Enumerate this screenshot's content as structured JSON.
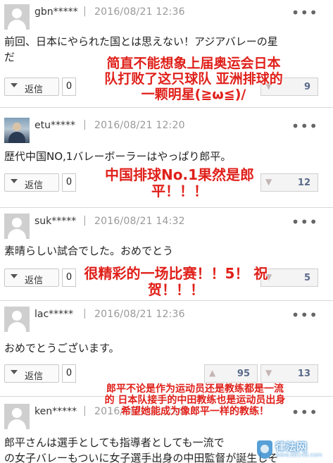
{
  "comments": [
    {
      "user": "gbn*****",
      "sep": "|",
      "date": "2016/08/21 12:36",
      "text_lines": [
        "前回、日本にやられた国とは思えない！アジアバレーの星",
        "だ"
      ],
      "reply_label": "返信",
      "reply_count": "0",
      "like_count": "",
      "dislike_count": "9",
      "more": "•••",
      "overlay": [
        "简直不能想象上届奥运会日本",
        "队打败了这只球队 亚洲排球的",
        "一颗明星(≧ω≦)/"
      ]
    },
    {
      "user": "etu*****",
      "sep": "|",
      "date": "2016/08/21 12:20",
      "text_lines": [
        "歴代中国NO,1バレーボーラーはやっぱり郎平。"
      ],
      "reply_label": "返信",
      "reply_count": "0",
      "like_count": "",
      "dislike_count": "12",
      "more": "•••",
      "overlay": [
        "中国排球No.1果然是郎",
        "平！！！"
      ]
    },
    {
      "user": "suk*****",
      "sep": "|",
      "date": "2016/08/21 14:32",
      "text_lines": [
        "素晴らしい試合でした。おめでとう"
      ],
      "reply_label": "返信",
      "reply_count": "0",
      "like_count": "",
      "dislike_count": "5",
      "more": "•••",
      "overlay": [
        "很精彩的一场比赛！！5！ 祝",
        "贺！！！"
      ]
    },
    {
      "user": "lac*****",
      "sep": "|",
      "date": "2016/08/21 12:36",
      "text_lines": [
        "おめでとうございます。"
      ],
      "reply_label": "返信",
      "reply_count": "0",
      "like_count": "95",
      "dislike_count": "13",
      "more": "•••",
      "overlay": [
        "郎平不论是作为运动员还是教练都是一流",
        "的 日本队接手的中田教练也是运动员出身",
        "希望她能成为像郎平一样的教练！"
      ]
    },
    {
      "user": "ken*****",
      "sep": "|",
      "date": "2016/08/21 13:30",
      "text_lines": [
        "郎平さんは選手としても指導者としても一流で",
        "の女子バレーもついに女子選手出身の中田監督が誕生しそ"
      ],
      "more": "•••"
    }
  ],
  "icons": {
    "like": "thumb-up-icon",
    "dislike": "thumb-down-icon",
    "more": "more-dots-icon",
    "reply": "caret-down-icon"
  },
  "watermark": {
    "text": "律法网",
    "sub": "www.88148.com"
  },
  "colors": {
    "overlay": "#e0201a",
    "vote_text": "#5a6a8a",
    "border": "#d8d8d8"
  }
}
